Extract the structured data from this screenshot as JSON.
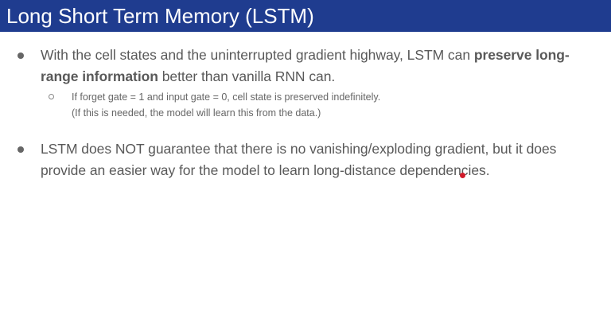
{
  "slide": {
    "title": "Long Short Term Memory (LSTM)",
    "bullets": [
      {
        "text_before": "With the cell states and the uninterrupted gradient highway, LSTM can ",
        "emphasis": "preserve long-range information",
        "text_after": " better than vanilla RNN can.",
        "sub_bullets": [
          {
            "line1": "If forget gate = 1 and input gate = 0, cell state is preserved indefinitely.",
            "line2": "(If this is needed, the model will learn this from the data.)"
          }
        ]
      },
      {
        "text": "LSTM does NOT guarantee that there is no vanishing/exploding gradient, but it does provide an easier way for the model to learn long-distance dependencies."
      }
    ]
  },
  "colors": {
    "title_bar": "#1f3c8f",
    "title_text": "#ffffff",
    "body_text": "#595959",
    "pointer": "#d11a2a"
  }
}
